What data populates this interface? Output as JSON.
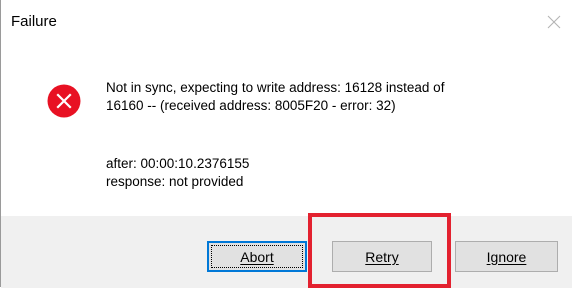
{
  "dialog": {
    "title": "Failure",
    "icon": "error-icon",
    "message_line1": "Not in sync, expecting to write address: 16128 instead of",
    "message_line2": "16160  -- (received address: 8005F20 - error: 32)",
    "detail_line1": "after: 00:00:10.2376155",
    "detail_line2": "response: not provided"
  },
  "buttons": {
    "abort_label": "Abort",
    "retry_label": "Retry",
    "ignore_label": "Ignore"
  },
  "colors": {
    "error_red": "#e81123",
    "focus_blue": "#0078d7",
    "highlight_red": "#e3212f",
    "footer_bg": "#f0f0f0"
  }
}
